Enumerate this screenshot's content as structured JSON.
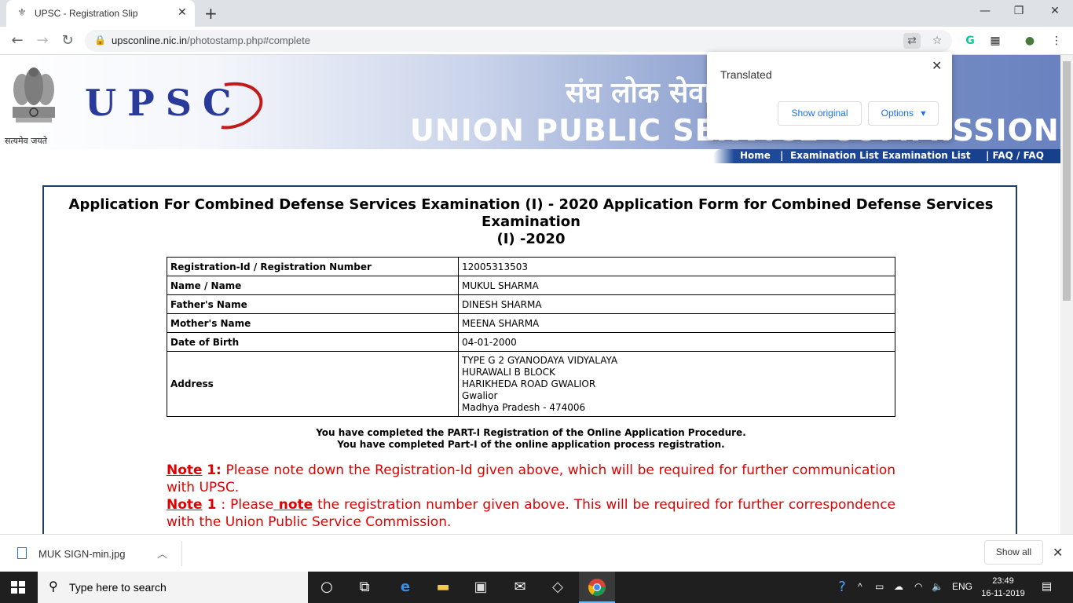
{
  "browser": {
    "tab_title": "UPSC - Registration Slip",
    "url_host": "upsconline.nic.in",
    "url_path": "/photostamp.php#complete"
  },
  "banner": {
    "motto": "सत्यमेव जयते",
    "logo_text": "UPSC",
    "hindi_title": "संघ लोक सेवा आयोग",
    "english_title": "UNION PUBLIC SERVICE COMMISSION"
  },
  "nav": {
    "home": "Home",
    "separator": "|",
    "exam_list": "Examination List Examination List",
    "faq": "| FAQ / FAQ"
  },
  "translate_popup": {
    "title": "Translated",
    "show_original": "Show original",
    "options": "Options"
  },
  "page": {
    "heading_line1": "Application For Combined Defense Services Examination (I) - 2020 Application Form for Combined Defense Services",
    "heading_line2": "Examination",
    "heading_line3": "(I) -2020",
    "table": [
      {
        "label": "Registration-Id / Registration Number",
        "value": "12005313503"
      },
      {
        "label": "Name / Name",
        "value": "MUKUL SHARMA"
      },
      {
        "label": "Father's Name",
        "value": "DINESH SHARMA"
      },
      {
        "label": "Mother's Name",
        "value": "MEENA SHARMA"
      },
      {
        "label": "Date of Birth",
        "value": "04-01-2000"
      }
    ],
    "address_label": "Address",
    "address_lines": [
      "TYPE G 2 GYANODAYA VIDYALAYA",
      "HURAWALI B BLOCK",
      "HARIKHEDA ROAD GWALIOR",
      "Gwalior",
      "Madhya Pradesh - 474006"
    ],
    "completion_line1": "You have completed the PART-I Registration of the Online Application Procedure.",
    "completion_line2": "You have completed Part-I of the online application process registration.",
    "note1_label": "Note",
    "note1_num": "1:",
    "note1_text": " Please note down the Registration-Id given above, which will be required for further communication with UPSC.",
    "note2_label": "Note",
    "note2_num": "1",
    "note2_mid": " : Please",
    "note2_note": " note",
    "note2_text": " the registration number given above. This will be required for further correspondence with the Union Public Service Commission."
  },
  "downloads": {
    "file_name": "MUK SIGN-min.jpg",
    "show_all": "Show all"
  },
  "taskbar": {
    "search_placeholder": "Type here to search",
    "language": "ENG",
    "time": "23:49",
    "date": "16-11-2019"
  },
  "colors": {
    "note_red": "#e00000",
    "nav_blue": "#163f8c",
    "box_border": "#1b3f66"
  }
}
